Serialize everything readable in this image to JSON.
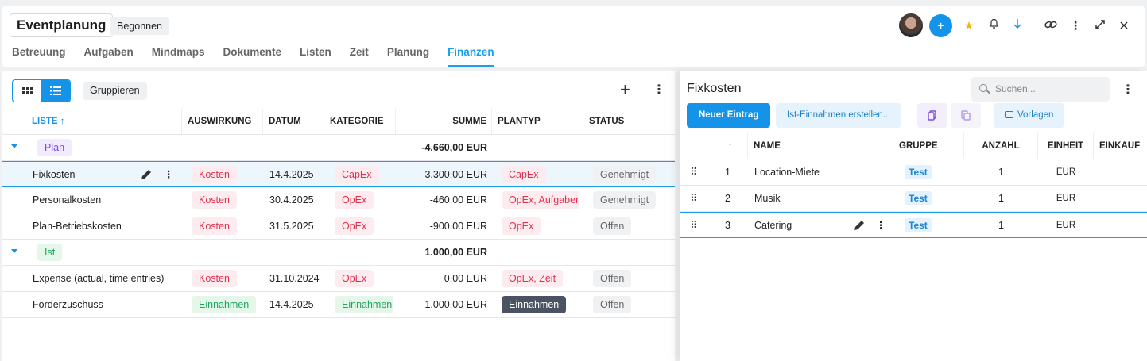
{
  "header": {
    "title": "Eventplanung",
    "status": "Begonnen",
    "tabs": [
      {
        "label": "Betreuung"
      },
      {
        "label": "Aufgaben"
      },
      {
        "label": "Mindmaps"
      },
      {
        "label": "Dokumente"
      },
      {
        "label": "Listen"
      },
      {
        "label": "Zeit"
      },
      {
        "label": "Planung"
      },
      {
        "label": "Finanzen",
        "active": true
      }
    ],
    "actions": {
      "add_label": "+",
      "icons": [
        "star-icon",
        "bell-icon",
        "arrow-down-icon",
        "link-icon",
        "more-vertical-icon",
        "expand-icon",
        "close-icon"
      ]
    }
  },
  "left": {
    "group_button": "Gruppieren",
    "columns": {
      "liste": "LISTE",
      "auswirkung": "AUSWIRKUNG",
      "datum": "DATUM",
      "kategorie": "KATEGORIE",
      "summe": "SUMME",
      "plantyp": "PLANTYP",
      "status": "STATUS"
    },
    "groups": [
      {
        "label": "Plan",
        "total": "-4.660,00 EUR",
        "rows": [
          {
            "name": "Fixkosten",
            "auswirkung": "Kosten",
            "datum": "14.4.2025",
            "kategorie": "CapEx",
            "summe": "-3.300,00 EUR",
            "plantyp": "CapEx",
            "status": "Genehmigt"
          },
          {
            "name": "Personalkosten",
            "auswirkung": "Kosten",
            "datum": "30.4.2025",
            "kategorie": "OpEx",
            "summe": "-460,00 EUR",
            "plantyp": "OpEx, Aufgaben",
            "status": "Genehmigt"
          },
          {
            "name": "Plan-Betriebskosten",
            "auswirkung": "Kosten",
            "datum": "31.5.2025",
            "kategorie": "OpEx",
            "summe": "-900,00 EUR",
            "plantyp": "OpEx",
            "status": "Offen"
          }
        ]
      },
      {
        "label": "Ist",
        "total": "1.000,00 EUR",
        "rows": [
          {
            "name": "Expense (actual, time entries)",
            "auswirkung": "Kosten",
            "datum": "31.10.2024",
            "kategorie": "OpEx",
            "summe": "0,00 EUR",
            "plantyp": "OpEx, Zeit",
            "status": "Offen"
          },
          {
            "name": "Förderzuschuss",
            "auswirkung": "Einnahmen",
            "datum": "14.4.2025",
            "kategorie": "Einnahmen",
            "summe": "1.000,00 EUR",
            "plantyp": "Einnahmen",
            "status": "Offen"
          }
        ]
      }
    ]
  },
  "right": {
    "title": "Fixkosten",
    "search_placeholder": "Suchen...",
    "new_entry": "Neuer Eintrag",
    "create_actual": "Ist-Einnahmen erstellen...",
    "templates": "Vorlagen",
    "columns": {
      "name": "NAME",
      "gruppe": "GRUPPE",
      "anzahl": "ANZAHL",
      "einheit": "EINHEIT",
      "einkauf": "EINKAUF"
    },
    "rows": [
      {
        "nr": "1",
        "name": "Location-Miete",
        "gruppe": "Test",
        "anzahl": "1",
        "einheit": "EUR"
      },
      {
        "nr": "2",
        "name": "Musik",
        "gruppe": "Test",
        "anzahl": "1",
        "einheit": "EUR"
      },
      {
        "nr": "3",
        "name": "Catering",
        "gruppe": "Test",
        "anzahl": "1",
        "einheit": "EUR"
      }
    ]
  }
}
